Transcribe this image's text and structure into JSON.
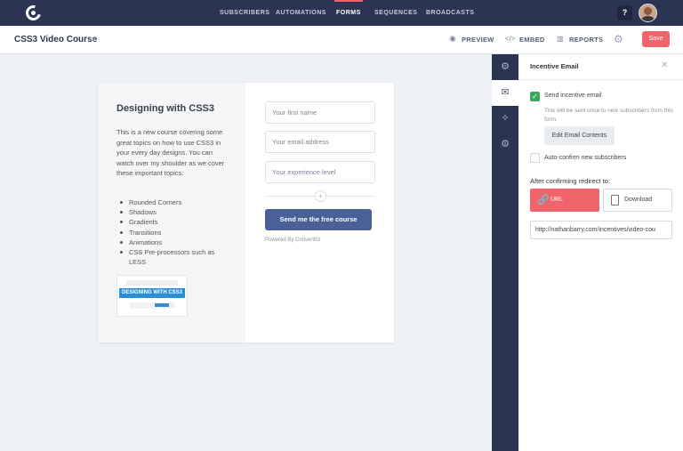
{
  "topnav": {
    "items": [
      {
        "label": "SUBSCRIBERS",
        "active": false
      },
      {
        "label": "AUTOMATIONS",
        "active": false
      },
      {
        "label": "FORMS",
        "active": true
      },
      {
        "label": "SEQUENCES",
        "active": false
      },
      {
        "label": "BROADCASTS",
        "active": false
      }
    ],
    "help_label": "?"
  },
  "header": {
    "title": "CSS3 Video Course",
    "preview_label": "PREVIEW",
    "embed_label": "EMBED",
    "reports_label": "REPORTS",
    "save_label": "Save"
  },
  "form_card": {
    "heading": "Designing with CSS3",
    "description": "This is a new course covering some great topics on how to use CSS3 in your every day designs. You can watch over my shoulder as we cover these important topics:",
    "topics": [
      "Rounded Corners",
      "Shadows",
      "Gradients",
      "Transitions",
      "Animations",
      "CSS Pre-processors such as LESS"
    ],
    "thumbnail_banner": "DESIGNING WITH CSS3",
    "fields": [
      {
        "placeholder": "Your first name"
      },
      {
        "placeholder": "Your email address"
      },
      {
        "placeholder": "Your experience level"
      }
    ],
    "submit_label": "Send me the free course",
    "powered_by": "Powered By ConvertKit"
  },
  "panel": {
    "title": "Incentive Email",
    "send_incentive_label": "Send incentive email",
    "send_incentive_checked": true,
    "send_incentive_help": "This will be sent once to new subscribers from this form.",
    "edit_email_label": "Edit Email Contents",
    "auto_confirm_label": "Auto-confirm new subscribers",
    "auto_confirm_checked": false,
    "redirect_label": "After confirming redirect to:",
    "redirect_options": [
      {
        "label": "URL",
        "selected": true
      },
      {
        "label": "Download",
        "selected": false
      }
    ],
    "redirect_url": "http://nathanbarry.com/incentives/video-cou"
  },
  "colors": {
    "nav_bg": "#2b3553",
    "accent": "#f0646c",
    "submit_button": "#4a6096",
    "checkbox_checked": "#3ca85b"
  }
}
